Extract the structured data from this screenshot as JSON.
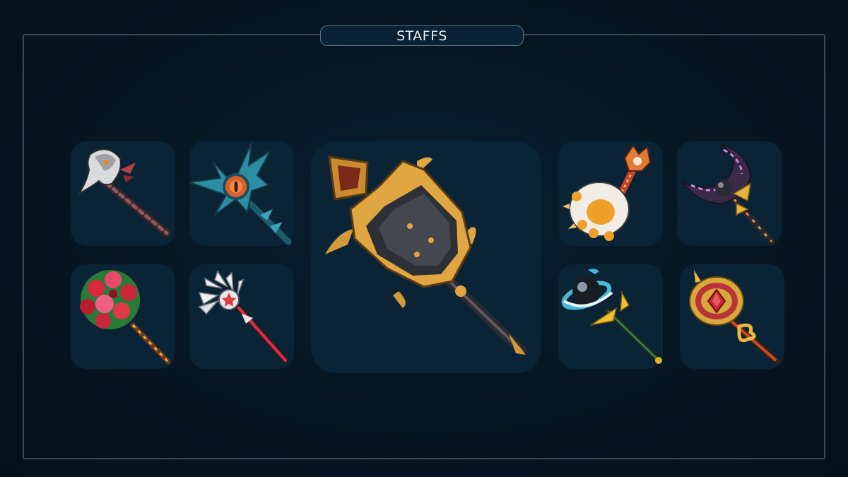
{
  "header": {
    "title": "STAFFS"
  },
  "staffs": [
    {
      "icon": "plague-mask-staff-icon"
    },
    {
      "icon": "sea-eye-staff-icon"
    },
    {
      "icon": "golden-spiked-mace-staff-icon",
      "selected": true
    },
    {
      "icon": "paw-cat-staff-icon"
    },
    {
      "icon": "crescent-moon-staff-icon"
    },
    {
      "icon": "rose-bouquet-staff-icon"
    },
    {
      "icon": "feather-star-wand-icon"
    },
    {
      "icon": "blue-orb-staff-icon"
    },
    {
      "icon": "ruby-crown-scepter-icon"
    }
  ],
  "colors": {
    "background": "#061520",
    "frame": "#3a4a55",
    "slot": "#0a2335",
    "title_text": "#e8eef2"
  }
}
